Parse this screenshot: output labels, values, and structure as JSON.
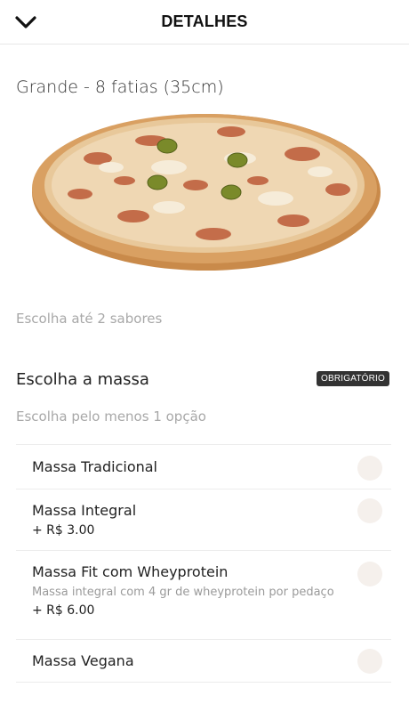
{
  "header": {
    "title": "DETALHES",
    "back_icon": "chevron-down-icon"
  },
  "product": {
    "size_title": "Grande - 8 fatias (35cm)",
    "flavors_hint": "Escolha até 2 sabores"
  },
  "dough_section": {
    "title": "Escolha a massa",
    "badge": "OBRIGATÓRIO",
    "subtitle": "Escolha pelo menos 1 opção",
    "options": [
      {
        "name": "Massa Tradicional",
        "description": "",
        "price": ""
      },
      {
        "name": "Massa Integral",
        "description": "",
        "price": "+ R$ 3.00"
      },
      {
        "name": "Massa Fit com Wheyprotein",
        "description": "Massa integral com 4 gr de wheyprotein por pedaço",
        "price": "+ R$ 6.00"
      },
      {
        "name": "Massa Vegana",
        "description": "",
        "price": ""
      }
    ]
  },
  "colors": {
    "badge_bg": "#333333",
    "muted_text": "#a8a8a8",
    "radio_fill": "#f5f0ec"
  }
}
